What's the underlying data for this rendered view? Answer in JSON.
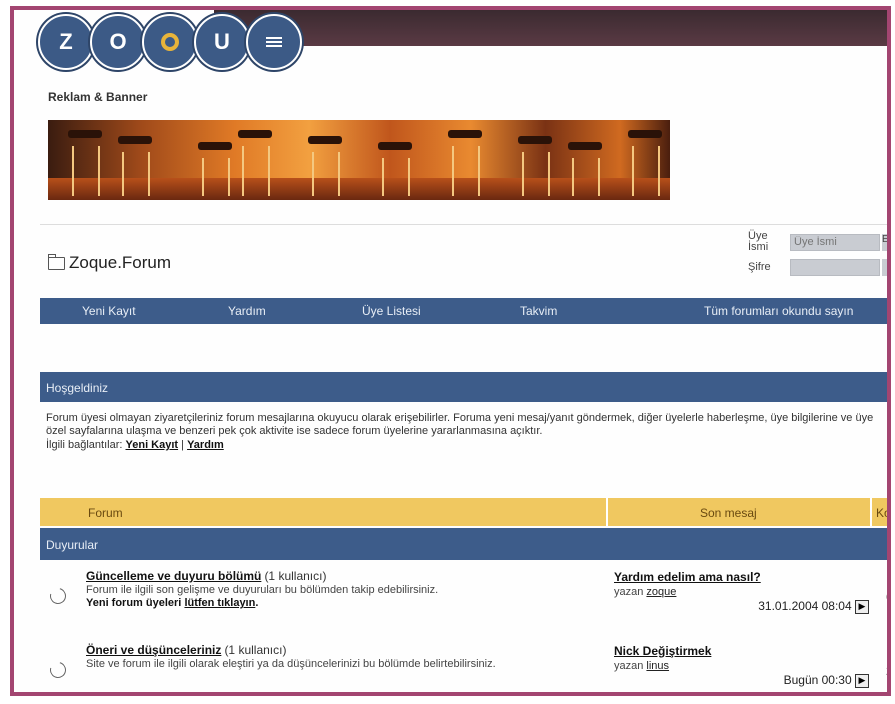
{
  "logo": {
    "letters": [
      "Z",
      "O",
      "",
      "U",
      ""
    ],
    "icon_names": [
      "z-letter-icon",
      "o-letter-icon",
      "q-ring-icon",
      "u-letter-icon",
      "menu-lines-icon"
    ]
  },
  "ads": {
    "title": "Reklam & Banner"
  },
  "forum": {
    "title": "Zoque.Forum"
  },
  "login": {
    "username_label": "Üye İsmi",
    "username_placeholder": "Üye İsmi",
    "password_label": "Şifre",
    "cut_char": "E"
  },
  "nav": {
    "items": [
      "Yeni Kayıt",
      "Yardım",
      "Üye Listesi",
      "Takvim",
      "Tüm forumları okundu sayın"
    ]
  },
  "welcome": {
    "header": "Hoşgeldiniz",
    "text": "Forum üyesi olmayan ziyaretçileriniz forum mesajlarına okuyucu olarak erişebilirler. Foruma yeni mesaj/yanıt göndermek, diğer üyelerle haberleşme, üye bilgilerine ve üye özel sayfalarına ulaşma ve benzeri pek çok aktivite ise sadece forum üyelerine yararlanmasına açıktır.",
    "links_label": "İlgili bağlantılar:",
    "link1": "Yeni Kayıt",
    "separator": "|",
    "link2": "Yardım"
  },
  "columns": {
    "forum": "Forum",
    "last": "Son mesaj",
    "cut": "Ko"
  },
  "section": {
    "title": "Duyurular"
  },
  "rows": [
    {
      "title": "Güncelleme ve duyuru bölümü",
      "count": "(1 kullanıcı)",
      "desc": "Forum ile ilgili son gelişme ve duyuruları bu bölümden takip edebilirsiniz.",
      "extra_prefix": "Yeni forum üyeleri",
      "extra_link": "lütfen tıklayın",
      "extra_suffix": ".",
      "last_title": "Yardım edelim ama nasıl?",
      "last_by_label": "yazan",
      "last_by": "zoque",
      "last_date": "31.01.2004 08:04",
      "edge": "6"
    },
    {
      "title": "Öneri ve düşünceleriniz",
      "count": "(1 kullanıcı)",
      "desc": "Site ve forum ile ilgili olarak eleştiri ya da düşüncelerinizi bu bölümde belirtebilirsiniz.",
      "last_title": "Nick Değiştirmek",
      "last_by_label": "yazan",
      "last_by": "linus",
      "last_date": "Bugün 00:30",
      "edge": "2"
    }
  ],
  "colors": {
    "frame": "#a34571",
    "nav": "#3d5c8a",
    "column_header": "#f0c860",
    "accent": "#e8b43a"
  }
}
